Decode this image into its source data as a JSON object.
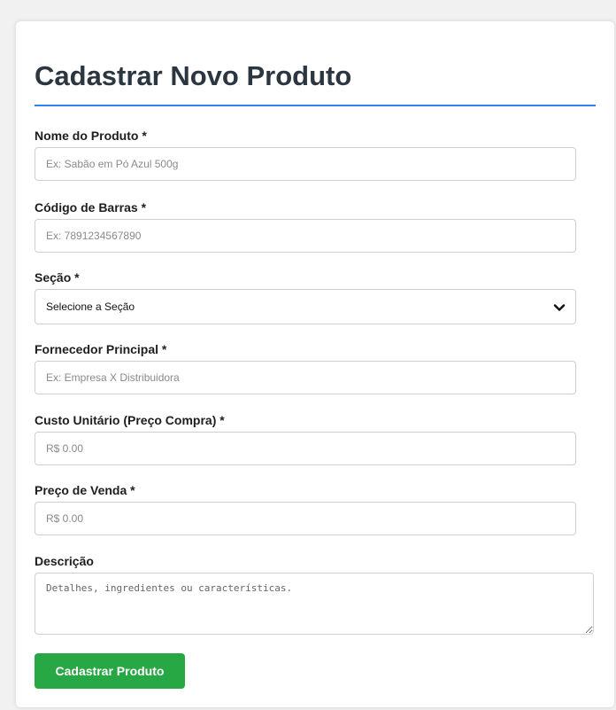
{
  "page": {
    "title": "Cadastrar Novo Produto"
  },
  "form": {
    "fields": {
      "nome": {
        "label": "Nome do Produto *",
        "placeholder": "Ex: Sabão em Pó Azul 500g"
      },
      "codigo": {
        "label": "Código de Barras *",
        "placeholder": "Ex: 7891234567890"
      },
      "secao": {
        "label": "Seção *",
        "selected": "Selecione a Seção"
      },
      "fornecedor": {
        "label": "Fornecedor Principal *",
        "placeholder": "Ex: Empresa X Distribuidora"
      },
      "custo": {
        "label": "Custo Unitário (Preço Compra) *",
        "placeholder": "R$ 0.00"
      },
      "venda": {
        "label": "Preço de Venda *",
        "placeholder": "R$ 0.00"
      },
      "descricao": {
        "label": "Descrição",
        "placeholder": "Detalhes, ingredientes ou características."
      }
    },
    "submit_label": "Cadastrar Produto"
  },
  "colors": {
    "accent_rule": "#2f80ed",
    "submit_bg": "#28a745"
  },
  "icons": {
    "select_arrow": "chevron-down-icon"
  }
}
